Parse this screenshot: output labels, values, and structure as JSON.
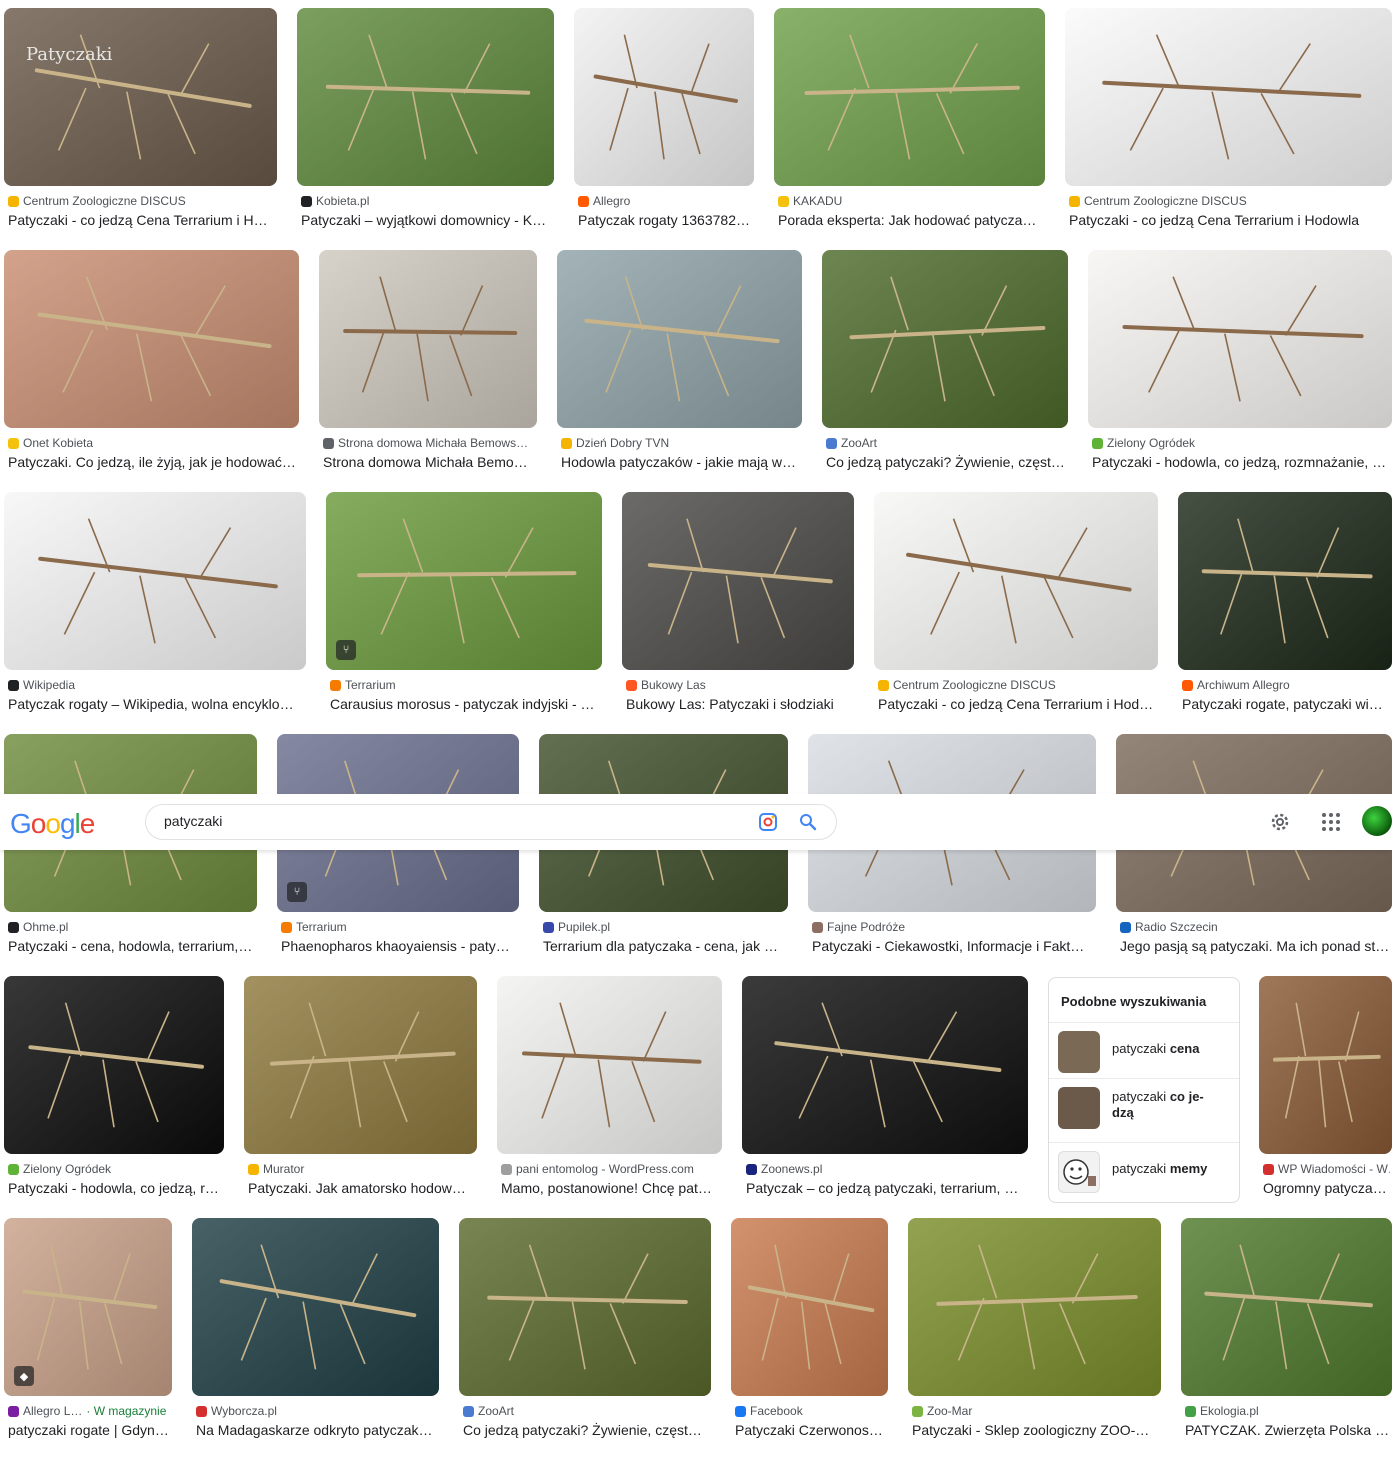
{
  "search": {
    "query": "patyczaki",
    "logo": "Google"
  },
  "header_icons": [
    "camera-lens-icon",
    "search-icon",
    "settings-gear-icon",
    "apps-grid-icon",
    "account-avatar"
  ],
  "results": [
    {
      "source": "Centrum Zoologiczne DISCUS",
      "title": "Patyczaki - co jedzą Cena Terrarium i H…",
      "overlay": "Patyczaki",
      "fav": "#f4b400",
      "bg": "#6b5a4a"
    },
    {
      "source": "Kobieta.pl",
      "title": "Patyczaki – wyjątkowi domownicy - K…",
      "fav": "#202124",
      "bg": "#5f8a3c"
    },
    {
      "source": "Allegro",
      "title": "Patyczak rogaty 1363782…",
      "fav": "#ff5a00",
      "bg": "#f1f1f1"
    },
    {
      "source": "KAKADU",
      "title": "Porada eksperta: Jak hodować patycza…",
      "fav": "#f4c20d",
      "bg": "#6fa04a"
    },
    {
      "source": "Centrum Zoologiczne DISCUS",
      "title": "Patyczaki - co jedzą Cena Terrarium i Hodowla",
      "fav": "#f4b400",
      "bg": "#fafafa"
    },
    {
      "source": "Onet Kobieta",
      "title": "Patyczaki. Co jedzą, ile żyją, jak je hodować…",
      "fav": "#f4c20d",
      "bg": "#c98e72"
    },
    {
      "source": "Strona domowa Michała Bemows…",
      "title": "Strona domowa Michała Bemo…",
      "fav": "#5f6368",
      "bg": "#cfc9be"
    },
    {
      "source": "Dzień Dobry TVN",
      "title": "Hodowla patyczaków - jakie mają w…",
      "fav": "#f4b400",
      "bg": "#8fa3a8"
    },
    {
      "source": "ZooArt",
      "title": "Co jedzą patyczaki? Żywienie, częst…",
      "fav": "#4a7bd0",
      "bg": "#4e6b2c"
    },
    {
      "source": "Zielony Ogródek",
      "title": "Patyczaki - hodowla, co jedzą, rozmnażanie, te…",
      "fav": "#5fb336",
      "bg": "#f7f5f2"
    },
    {
      "source": "Wikipedia",
      "title": "Patyczak rogaty – Wikipedia, wolna encyklo…",
      "fav": "#202124",
      "bg": "#f6f6f6"
    },
    {
      "source": "Terrarium",
      "title": "Carausius morosus - patyczak indyjski - …",
      "fav": "#f57c00",
      "bg": "#6b9a3c"
    },
    {
      "source": "Bukowy Las",
      "title": "Bukowy Las: Patyczaki i słodziaki",
      "fav": "#ff5722",
      "bg": "#4b4a47"
    },
    {
      "source": "Centrum Zoologiczne DISCUS",
      "title": "Patyczaki - co jedzą Cena Terrarium i Hod…",
      "fav": "#f4b400",
      "bg": "#f7f7f5"
    },
    {
      "source": "Archiwum Allegro",
      "title": "Patyczaki rogate, patyczaki wiet…",
      "fav": "#ff5a00",
      "bg": "#1d2a1a"
    },
    {
      "source": "Ohme.pl",
      "title": "Patyczaki - cena, hodowla, terrarium,…",
      "fav": "#202124",
      "bg": "#6e8b3d"
    },
    {
      "source": "Terrarium",
      "title": "Phaenopharos khaoyaiensis - paty…",
      "fav": "#f57c00",
      "bg": "#6a6f8e"
    },
    {
      "source": "Pupilek.pl",
      "title": "Terrarium dla patyczaka - cena, jak …",
      "fav": "#3949ab",
      "bg": "#41502c"
    },
    {
      "source": "Fajne Podróże",
      "title": "Patyczaki - Ciekawostki, Informacje i Fakt…",
      "fav": "#8d6e63",
      "bg": "#d9dde2"
    },
    {
      "source": "Radio Szczecin",
      "title": "Jego pasją są patyczaki. Ma ich ponad st…",
      "fav": "#1565c0",
      "bg": "#7d6b5c"
    },
    {
      "source": "Zielony Ogródek",
      "title": "Patyczaki - hodowla, co jedzą, r…",
      "fav": "#5fb336",
      "bg": "#0c0c0c"
    },
    {
      "source": "Murator",
      "title": "Patyczaki. Jak amatorsko hodow…",
      "fav": "#f4b400",
      "bg": "#8f7a3e"
    },
    {
      "source": "pani entomolog - WordPress.com",
      "title": "Mamo, postanowione! Chcę pat…",
      "fav": "#9e9e9e",
      "bg": "#f2f2f0"
    },
    {
      "source": "Zoonews.pl",
      "title": "Patyczak – co jedzą patyczaki, terrarium, …",
      "fav": "#1a237e",
      "bg": "#101010"
    },
    {
      "source": "WP Wiadomości - W…",
      "title": "Ogromny patyczak …",
      "fav": "#d32f2f",
      "bg": "#8a5a36"
    },
    {
      "source": "Allegro L…",
      "extra": "· W magazynie",
      "title": "patyczaki rogate | Gdyn…",
      "fav": "#7b1fa2",
      "bg": "#c9a189"
    },
    {
      "source": "Wyborcza.pl",
      "title": "Na Madagaskarze odkryto patyczak…",
      "fav": "#d32f2f",
      "bg": "#1f3f45"
    },
    {
      "source": "ZooArt",
      "title": "Co jedzą patyczaki? Żywienie, częst…",
      "fav": "#4a7bd0",
      "bg": "#5b6b2e"
    },
    {
      "source": "Facebook",
      "title": "Patyczaki Czerwonos…",
      "fav": "#1877f2",
      "bg": "#c87b4e"
    },
    {
      "source": "Zoo-Mar",
      "title": "Patyczaki - Sklep zoologiczny ZOO-…",
      "fav": "#7cb342",
      "bg": "#7a8e2a"
    },
    {
      "source": "Ekologia.pl",
      "title": "PATYCZAK. Zwierzęta Polska - …",
      "fav": "#43a047",
      "bg": "#4f7a2c"
    }
  ],
  "related": {
    "title": "Podobne wyszukiwania",
    "items": [
      {
        "prefix": "patyczaki ",
        "bold": "cena"
      },
      {
        "prefix": "patyczaki ",
        "bold": "co je-dzą"
      },
      {
        "prefix": "patyczaki ",
        "bold": "memy"
      }
    ]
  }
}
